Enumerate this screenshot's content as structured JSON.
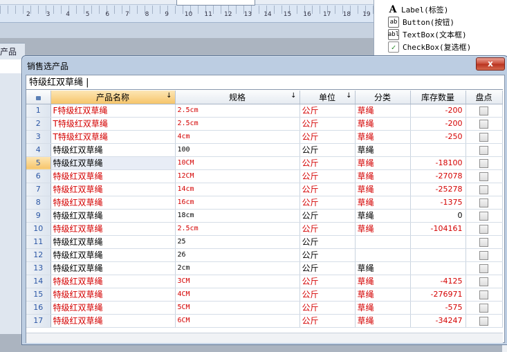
{
  "ruler": {
    "numbers": [
      "2",
      "3",
      "4",
      "5",
      "6",
      "7",
      "8",
      "9",
      "10",
      "11",
      "12",
      "13",
      "14",
      "15",
      "16",
      "17",
      "18",
      "19"
    ]
  },
  "background": {
    "panel_label": "产品"
  },
  "toolbox": {
    "items": [
      {
        "icon": "label-icon",
        "glyph": "A",
        "label": "Label(标签)"
      },
      {
        "icon": "button-icon",
        "glyph": "ab",
        "label": "Button(按钮)"
      },
      {
        "icon": "textbox-icon",
        "glyph": "abl",
        "label": "TextBox(文本框)"
      },
      {
        "icon": "checkbox-icon",
        "glyph": "✓",
        "label": "CheckBox(复选框)"
      }
    ]
  },
  "dialog": {
    "title": "销售选产品",
    "close_glyph": "x",
    "search_value": "特级红双草绳 |",
    "columns": [
      {
        "key": "rownum",
        "label": ""
      },
      {
        "key": "name",
        "label": "产品名称",
        "sort": "↓"
      },
      {
        "key": "spec",
        "label": "规格",
        "sort": "↓"
      },
      {
        "key": "unit",
        "label": "单位",
        "sort": "↓"
      },
      {
        "key": "category",
        "label": "分类",
        "sort": ""
      },
      {
        "key": "stock",
        "label": "库存数量",
        "sort": ""
      },
      {
        "key": "check",
        "label": "盘点",
        "sort": ""
      }
    ],
    "rows": [
      {
        "n": "1",
        "name": "F特级红双草绳",
        "spec": "2.5cm",
        "unit": "公斤",
        "category": "草绳",
        "stock": "-200",
        "red": true
      },
      {
        "n": "2",
        "name": "T特级红双草绳",
        "spec": "2.5cm",
        "unit": "公斤",
        "category": "草绳",
        "stock": "-200",
        "red": true
      },
      {
        "n": "3",
        "name": "T特级红双草绳",
        "spec": "4cm",
        "unit": "公斤",
        "category": "草绳",
        "stock": "-250",
        "red": true
      },
      {
        "n": "4",
        "name": "特级红双草绳",
        "spec": "100",
        "unit": "公斤",
        "category": "草绳",
        "stock": "",
        "red": false
      },
      {
        "n": "5",
        "name": "特级红双草绳",
        "spec": "10CM",
        "unit": "公斤",
        "category": "草绳",
        "stock": "-18100",
        "red": true,
        "current": true
      },
      {
        "n": "6",
        "name": "特级红双草绳",
        "spec": "12CM",
        "unit": "公斤",
        "category": "草绳",
        "stock": "-27078",
        "red": true
      },
      {
        "n": "7",
        "name": "特级红双草绳",
        "spec": "14cm",
        "unit": "公斤",
        "category": "草绳",
        "stock": "-25278",
        "red": true
      },
      {
        "n": "8",
        "name": "特级红双草绳",
        "spec": "16cm",
        "unit": "公斤",
        "category": "草绳",
        "stock": "-1375",
        "red": true
      },
      {
        "n": "9",
        "name": "特级红双草绳",
        "spec": "18cm",
        "unit": "公斤",
        "category": "草绳",
        "stock": "0",
        "red": false
      },
      {
        "n": "10",
        "name": "特级红双草绳",
        "spec": "2.5cm",
        "unit": "公斤",
        "category": "草绳",
        "stock": "-104161",
        "red": true
      },
      {
        "n": "11",
        "name": "特级红双草绳",
        "spec": "25",
        "unit": "公斤",
        "category": "",
        "stock": "",
        "red": false
      },
      {
        "n": "12",
        "name": "特级红双草绳",
        "spec": "26",
        "unit": "公斤",
        "category": "",
        "stock": "",
        "red": false
      },
      {
        "n": "13",
        "name": "特级红双草绳",
        "spec": "2cm",
        "unit": "公斤",
        "category": "草绳",
        "stock": "",
        "red": false
      },
      {
        "n": "14",
        "name": "特级红双草绳",
        "spec": "3CM",
        "unit": "公斤",
        "category": "草绳",
        "stock": "-4125",
        "red": true
      },
      {
        "n": "15",
        "name": "特级红双草绳",
        "spec": "4CM",
        "unit": "公斤",
        "category": "草绳",
        "stock": "-276971",
        "red": true
      },
      {
        "n": "16",
        "name": "特级红双草绳",
        "spec": "5CM",
        "unit": "公斤",
        "category": "草绳",
        "stock": "-575",
        "red": true
      },
      {
        "n": "17",
        "name": "特级红双草绳",
        "spec": "6CM",
        "unit": "公斤",
        "category": "草绳",
        "stock": "-34247",
        "red": true
      }
    ]
  },
  "colors": {
    "negative_text": "#d40000",
    "header_selected": "#f6c56a",
    "row_number_text": "#2b56a5"
  }
}
